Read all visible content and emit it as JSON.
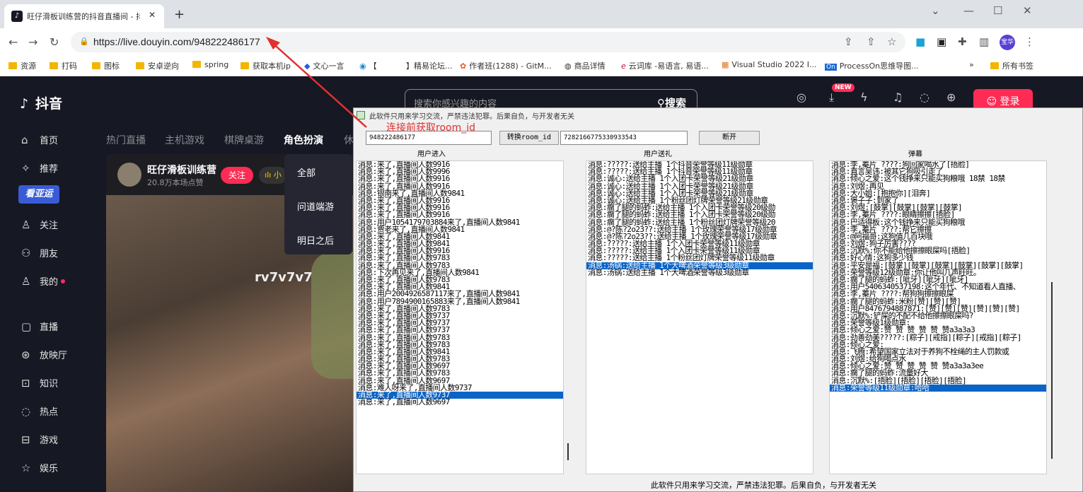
{
  "browser": {
    "tab_title": "旺仔滑板训练营的抖音直播间 - 抖音",
    "url": "https://live.douyin.com/948222486177",
    "bookmarks": [
      "资源",
      "打码",
      "图标",
      "安卓逆向",
      "spring",
      "获取本机ip",
      "文心一言",
      "【",
      "】精易论坛...",
      "作者班(1288) - GitM...",
      "商品详情",
      "云词库 -易语言, 易语...",
      "Visual Studio 2022 I...",
      "ProcessOn思维导图...",
      "»",
      "所有书签"
    ],
    "profile_label": "宝华"
  },
  "douyin": {
    "logo": "抖音",
    "search_placeholder": "搜索你感兴趣的内容",
    "search_button": "搜索",
    "new_badge": "NEW",
    "login_button": "登录",
    "sidebar": [
      "首页",
      "推荐",
      "关注",
      "朋友",
      "我的",
      "直播",
      "放映厅",
      "知识",
      "热点",
      "游戏",
      "娱乐"
    ],
    "promo_label": "看亚运",
    "categories": [
      "热门直播",
      "主机游戏",
      "棋牌桌游",
      "角色扮演",
      "休"
    ],
    "dropdown": [
      "全部",
      "问道端游",
      "明日之后"
    ],
    "streamer": {
      "name": "旺仔滑板训练营",
      "fans": "20.8万本场点赞",
      "follow": "关注",
      "stat": "ılı 小"
    },
    "video_label": "rv7v7v7"
  },
  "app": {
    "title": "此软件只用来学习交流，严禁违法犯罪。后果自负，与开发者无关",
    "room_input": "948222486177",
    "convert_button": "转换room_id",
    "room_id_value": "7282166775330933543",
    "disconnect_button": "断开",
    "col_enter": "用户进入",
    "col_gift": "用户送礼",
    "col_danmu": "弹幕",
    "footer": "此软件只用来学习交流，严禁违法犯罪。后果自负，与开发者无关",
    "enter_lines": [
      "消息:来了,直播间人数9916",
      "消息:来了,直播间人数9996",
      "消息:来了,直播间人数9916",
      "消息:来了,直播间人数9916",
      "消息:银南来了,直播间人数9841",
      "消息:来了,直播间人数9916",
      "消息:来了,直播间人数9916",
      "消息:来了,直播间人数9916",
      "消息:用户1054179703884来了,直播间人数9841",
      "消息:贾老来了,直播间人数9841",
      "消息:来了,直播间人数9841",
      "消息:来了,直播间人数9841",
      "消息:来了,直播间人数9916",
      "消息:来了,直播间人数9783",
      "消息:来了,直播间人数9783",
      "消息:下次再见来了,直播间人数9841",
      "消息:来了,直播间人数9783",
      "消息:来了,直播间人数9841",
      "消息:用户2004926587117来了,直播间人数9841",
      "消息:用户7894900165883来了,直播间人数9841",
      "消息:来了,直播间人数9783",
      "消息:来了,直播间人数9737",
      "消息:来了,直播间人数9737",
      "消息:来了,直播间人数9737",
      "消息:来了,直播间人数9783",
      "消息:来了,直播间人数9783",
      "消息:来了,直播间人数9841",
      "消息:来了,直播间人数9783",
      "消息:来了,直播间人数9697",
      "消息:来了,直播间人数9783",
      "消息:来了,直播间人数9697",
      "消息:难人呀来了,直播间人数9737",
      "消息:来了,直播间人数9737",
      "消息:来了,直播间人数9697"
    ],
    "enter_selected": 32,
    "gift_lines": [
      "消息:?????:送给主播 1个抖音荣誉等级11级勋章",
      "消息:?????:送给主播 1个抖音荣誉等级11级勋章",
      "消息:诚心:送给主播 1个入团卡荣誉等级21级勋章",
      "消息:诚心:送给主播 1个入团卡荣誉等级21级勋章",
      "消息:诚心:送给主播 1个入团卡荣誉等级21级勋章",
      "消息:诚心:送给主播 1个粉丝团灯牌荣誉等级21级勋章",
      "消息:瘸了腿的蚂蚱:送给主播 1个入团卡荣誉等级20级勋",
      "消息:瘸了腿的蚂蚱:送给主播 1个入团卡荣誉等级20级勋",
      "消息:瘸了腿的蚂蚱:送给主播 1个粉丝团灯牌荣誉等级20",
      "消息:@?陈?2o23??:送给主播 1个玫瑰荣誉等级17级勋章",
      "消息:@?陈?2o23??:送给主播 1个玫瑰荣誉等级17级勋章",
      "消息:?????:送给主播 1个入团卡荣誉等级11级勋章",
      "消息:?????:送给主播 1个入团卡荣誉等级11级勋章",
      "消息:?????:送给主播 1个粉丝团灯牌荣誉等级11级勋章",
      "消息:汤锅:送给主播 1个大啤酒荣誉等级3级勋章",
      "消息:汤锅:送给主播 1个大啤酒荣誉等级3级勋章"
    ],
    "gift_selected": 14,
    "danmu_lines": [
      "消息:李,蓁片 ????:狗回家喝水了[捂脸]",
      "消息:直言吴讳:被其它狗吸引走了",
      "消息:倾心之爱:这个钱挣来只能买狗粮哦 18禁  18禁",
      "消息:刘煜:再见",
      "消息:大小姐:[抱抱你][泪奔]",
      "消息:褒子子:到家了",
      "消息:刘煜:[鼓掌][鼓掌][鼓掌][鼓掌]",
      "消息:李,蓁片 ????:眼睛擦擦[捂脸]",
      "消息:巴适得板:这个钱挣来只能买狗粮哦",
      "消息:李,蓁片 ????:帮它擦擦",
      "消息:@阿福哥:这狗值几百块哦",
      "消息:刘煜:狗子厉害????",
      "消息:沉默%:你不能给他擦擦眼屎吗[捂脸]",
      "消息:好心情:这狗多少钱",
      "消息:平安是福:[鼓掌][鼓掌][鼓掌][鼓掌][鼓掌][鼓掌]",
      "消息:荣誉等级12级勋章:你让他叫几声旺旺。",
      "消息:瘸了腿的蚂蚱:[呲牙][呲牙][呲牙]",
      "消息:用户5406340537198:这个年代、不知道看人直播、",
      "消息:李,蓁片 ????:帮狗狗擦擦眼屎",
      "消息:瘸了腿的蚂蚱:米粉[赞][赞][赞]",
      "消息:用户8476794887871:[赞][赞][赞][赞][赞][赞]",
      "消息:沉默%:铲屎的不配不给他擦擦眼屎吗?",
      "消息:荣誉等级1级勋章:",
      "消息:倾心之爱:赞  赞  赞  赞  赞  赞a3a3a3",
      "消息:劲善劲美?????:[粽子][戒指][粽子][戒指][粽子]",
      "消息:倾心之爱:",
      "消息:飞腾:希望国家立法对于养狗不栓绳的主人罚款或",
      "消息:刘煜:给狗喝点水",
      "消息:倾心之爱:赞  赞  赞  赞  赞  赞a3a3a3ee",
      "消息:瘸了腿的蚂蚱:流量好大",
      "消息:沉默%:[捂脸][捂脸][捂脸][捂脸]",
      "消息:荣誉等级11级勋章:哈哈"
    ],
    "danmu_selected": 31
  },
  "annotation": "连接前获取room_id",
  "colors": {
    "douyin_red": "#fe2c55",
    "selection": "#0a64c8",
    "annotation": "#e03030"
  }
}
